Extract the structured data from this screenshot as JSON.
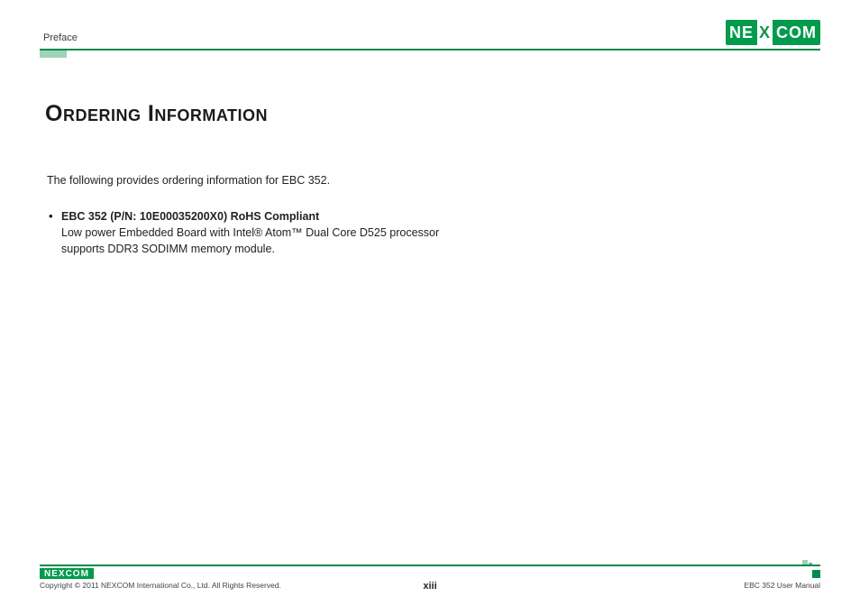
{
  "header": {
    "section": "Preface"
  },
  "logo": {
    "part1": "NE",
    "part2": "X",
    "part3": "COM"
  },
  "title": "Ordering Information",
  "intro": "The following provides ordering information for EBC 352.",
  "items": [
    {
      "title": "EBC 352 (P/N: 10E00035200X0) RoHS Compliant",
      "desc": "Low power Embedded Board with Intel® Atom™ Dual Core D525 processor supports DDR3 SODIMM memory module."
    }
  ],
  "footer": {
    "copyright": "Copyright © 2011 NEXCOM International Co., Ltd. All Rights Reserved.",
    "page": "xiii",
    "doc": "EBC 352 User Manual"
  }
}
